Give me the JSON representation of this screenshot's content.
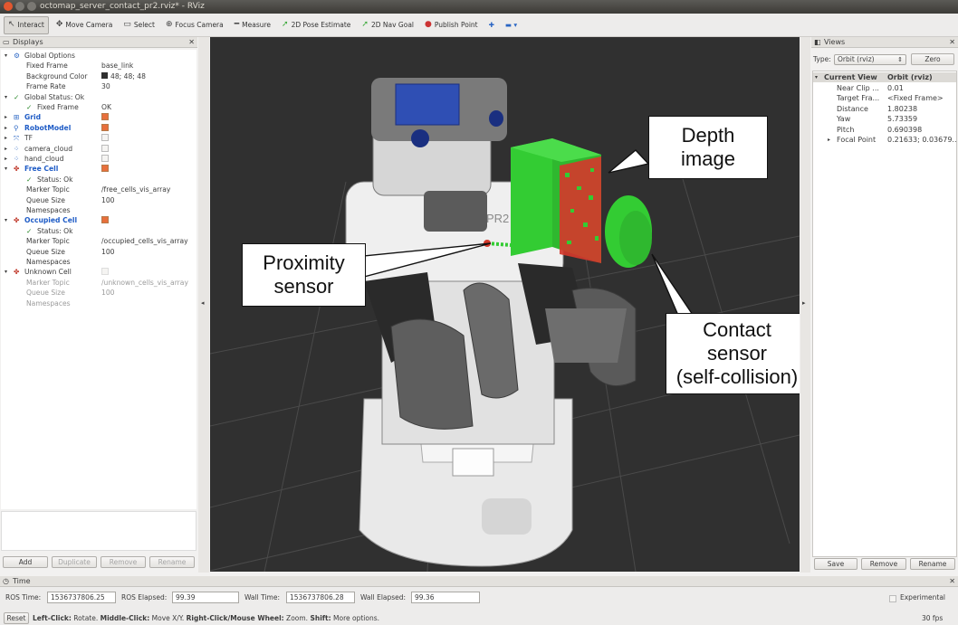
{
  "window": {
    "title": "octomap_server_contact_pr2.rviz* - RViz"
  },
  "toolbar": [
    {
      "label": "Interact",
      "icon": "interact-icon",
      "glyph": "↖",
      "active": true
    },
    {
      "label": "Move Camera",
      "icon": "move-camera-icon",
      "glyph": "✥",
      "active": false
    },
    {
      "label": "Select",
      "icon": "select-icon",
      "glyph": "▭",
      "active": false
    },
    {
      "label": "Focus Camera",
      "icon": "focus-camera-icon",
      "glyph": "⊕",
      "active": false
    },
    {
      "label": "Measure",
      "icon": "measure-icon",
      "glyph": "━",
      "active": false
    },
    {
      "label": "2D Pose Estimate",
      "icon": "pose-estimate-icon",
      "glyph": "➚",
      "active": false
    },
    {
      "label": "2D Nav Goal",
      "icon": "nav-goal-icon",
      "glyph": "➚",
      "active": false
    },
    {
      "label": "Publish Point",
      "icon": "publish-point-icon",
      "glyph": "●",
      "active": false
    }
  ],
  "displays": {
    "header": "Displays",
    "rows": [
      {
        "label": "Global Options",
        "indent": 0,
        "icon": "⚙",
        "value": ""
      },
      {
        "label": "Fixed Frame",
        "indent": 1,
        "value": "base_link"
      },
      {
        "label": "Background Color",
        "indent": 1,
        "value": "48; 48; 48",
        "swatch": true
      },
      {
        "label": "Frame Rate",
        "indent": 1,
        "value": "30"
      },
      {
        "label": "Global Status: Ok",
        "indent": 0,
        "icon": "✓",
        "value": ""
      },
      {
        "label": "Fixed Frame",
        "indent": 1,
        "icon": "✓",
        "value": "OK"
      },
      {
        "label": "Grid",
        "indent": 0,
        "icon": "⊞",
        "blue": true,
        "check": "on"
      },
      {
        "label": "RobotModel",
        "indent": 0,
        "icon": "⚲",
        "blue": true,
        "check": "on"
      },
      {
        "label": "TF",
        "indent": 0,
        "icon": "⤧",
        "check": "off"
      },
      {
        "label": "camera_cloud",
        "indent": 0,
        "icon": "⁘",
        "check": "off"
      },
      {
        "label": "hand_cloud",
        "indent": 0,
        "icon": "⁘",
        "check": "off"
      },
      {
        "label": "Free Cell",
        "indent": 0,
        "icon": "✤",
        "blue": true,
        "check": "on"
      },
      {
        "label": "Status: Ok",
        "indent": 1,
        "icon": "✓",
        "value": ""
      },
      {
        "label": "Marker Topic",
        "indent": 1,
        "value": "/free_cells_vis_array"
      },
      {
        "label": "Queue Size",
        "indent": 1,
        "value": "100"
      },
      {
        "label": "Namespaces",
        "indent": 1,
        "value": ""
      },
      {
        "label": "Occupied Cell",
        "indent": 0,
        "icon": "✤",
        "blue": true,
        "check": "on"
      },
      {
        "label": "Status: Ok",
        "indent": 1,
        "icon": "✓",
        "value": ""
      },
      {
        "label": "Marker Topic",
        "indent": 1,
        "value": "/occupied_cells_vis_array"
      },
      {
        "label": "Queue Size",
        "indent": 1,
        "value": "100"
      },
      {
        "label": "Namespaces",
        "indent": 1,
        "value": ""
      },
      {
        "label": "Unknown Cell",
        "indent": 0,
        "icon": "✤",
        "check": "dim"
      },
      {
        "label": "Marker Topic",
        "indent": 1,
        "value": "/unknown_cells_vis_array",
        "gray": true
      },
      {
        "label": "Queue Size",
        "indent": 1,
        "value": "100",
        "gray": true
      },
      {
        "label": "Namespaces",
        "indent": 1,
        "value": "",
        "gray": true
      }
    ],
    "buttons": {
      "add": "Add",
      "duplicate": "Duplicate",
      "remove": "Remove",
      "rename": "Rename"
    }
  },
  "views": {
    "header": "Views",
    "type_label": "Type:",
    "type_value": "Orbit (rviz)",
    "zero": "Zero",
    "current_view": "Current View",
    "current_value": "Orbit (rviz)",
    "props": [
      {
        "label": "Near Clip ...",
        "value": "0.01"
      },
      {
        "label": "Target Fra...",
        "value": "<Fixed Frame>"
      },
      {
        "label": "Distance",
        "value": "1.80238"
      },
      {
        "label": "Yaw",
        "value": "5.73359"
      },
      {
        "label": "Pitch",
        "value": "0.690398"
      },
      {
        "label": "Focal Point",
        "value": "0.21633; 0.03679..."
      }
    ],
    "buttons": {
      "save": "Save",
      "remove": "Remove",
      "rename": "Rename"
    }
  },
  "callouts": {
    "depth": [
      "Depth",
      "image"
    ],
    "proximity": [
      "Proximity",
      "sensor"
    ],
    "contact": [
      "Contact",
      "sensor",
      "(self-collision)"
    ]
  },
  "robot_label": "PR2",
  "time": {
    "header": "Time",
    "ros_time_label": "ROS Time:",
    "ros_time": "1536737806.25",
    "ros_elapsed_label": "ROS Elapsed:",
    "ros_elapsed": "99.39",
    "wall_time_label": "Wall Time:",
    "wall_time": "1536737806.28",
    "wall_elapsed_label": "Wall Elapsed:",
    "wall_elapsed": "99.36",
    "experimental": "Experimental"
  },
  "status": {
    "reset": "Reset",
    "hint_left_b": "Left-Click:",
    "hint_left": " Rotate. ",
    "hint_mid_b": "Middle-Click:",
    "hint_mid": " Move X/Y. ",
    "hint_right_b": "Right-Click/Mouse Wheel:",
    "hint_right": " Zoom. ",
    "hint_shift_b": "Shift:",
    "hint_shift": " More options.",
    "fps": "30 fps"
  },
  "colors": {
    "accent": "#e86f3c",
    "free_cell": "#33cc33",
    "occupied_cell": "#d33a2c",
    "viewport_bg": "#303030"
  }
}
